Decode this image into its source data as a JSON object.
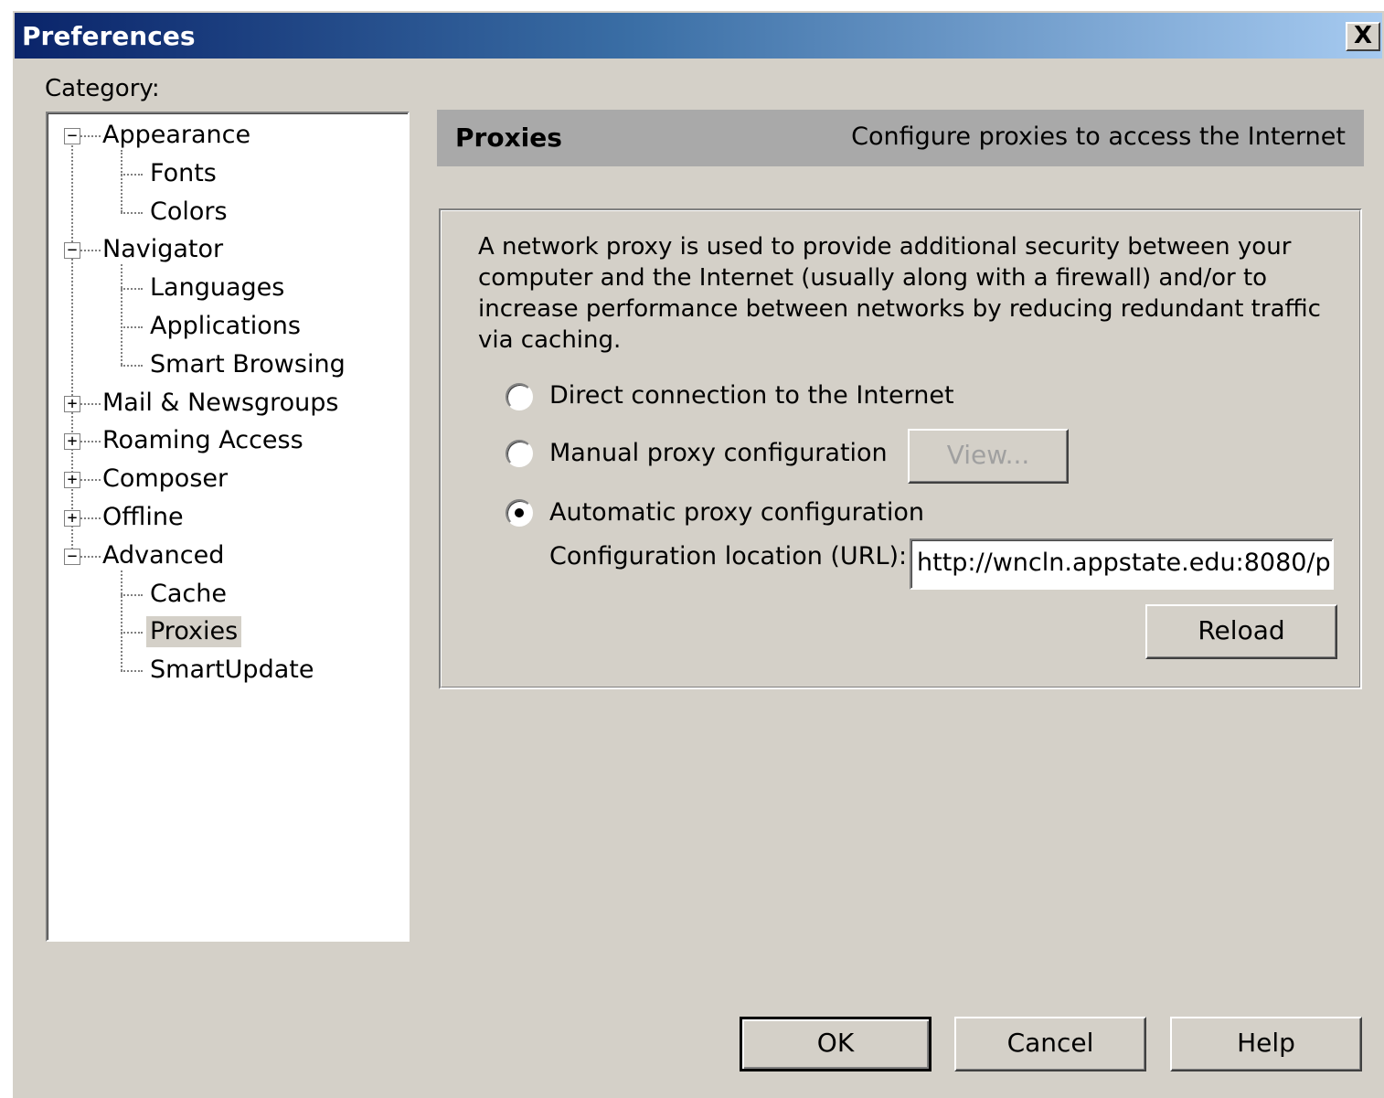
{
  "window": {
    "title": "Preferences",
    "close_glyph": "X"
  },
  "category_label": "Category:",
  "tree": {
    "expand_glyph": "+",
    "collapse_glyph": "−",
    "appearance": "Appearance",
    "fonts": "Fonts",
    "colors": "Colors",
    "navigator": "Navigator",
    "languages": "Languages",
    "applications": "Applications",
    "smart_browsing": "Smart Browsing",
    "mail": "Mail & Newsgroups",
    "roaming": "Roaming Access",
    "composer": "Composer",
    "offline": "Offline",
    "advanced": "Advanced",
    "cache": "Cache",
    "proxies": "Proxies",
    "smartupdate": "SmartUpdate",
    "selected": "Proxies"
  },
  "panel": {
    "title": "Proxies",
    "subtitle": "Configure proxies to access the Internet",
    "description": "A network proxy is used to provide additional security between your computer and the Internet (usually along with a firewall) and/or to increase performance between networks by reducing redundant traffic via caching.",
    "options": {
      "direct": "Direct connection to the Internet",
      "manual": "Manual proxy configuration",
      "automatic": "Automatic proxy configuration",
      "selected": "automatic"
    },
    "view_button": "View...",
    "url_label": "Configuration location (URL):",
    "url_value": "http://wncln.appstate.edu:8080/p",
    "reload_button": "Reload"
  },
  "buttons": {
    "ok": "OK",
    "cancel": "Cancel",
    "help": "Help"
  }
}
